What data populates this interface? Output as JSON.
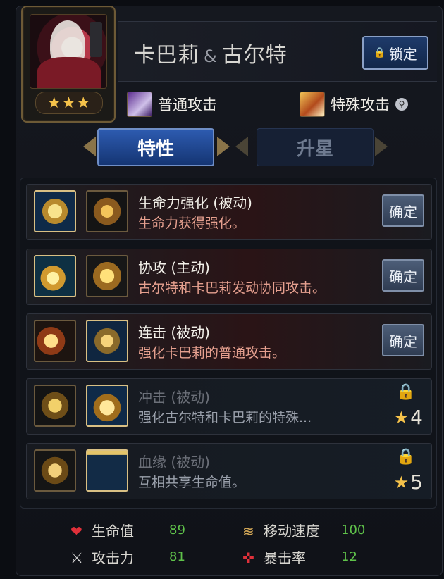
{
  "character": {
    "name_left": "卡巴莉",
    "name_amp": "&",
    "name_right": "古尔特",
    "stars": "★★★",
    "lock_label": "锁定"
  },
  "attacks": {
    "normal_label": "普通攻击",
    "special_label": "特殊攻击"
  },
  "tabs": [
    {
      "label": "特性",
      "active": true
    },
    {
      "label": "升星",
      "active": false
    }
  ],
  "traits": [
    {
      "title": "生命力强化 (被动)",
      "desc": "生命力获得强化。",
      "action": "确定",
      "locked": false
    },
    {
      "title": "协攻 (主动)",
      "desc": "古尔特和卡巴莉发动协同攻击。",
      "action": "确定",
      "locked": false
    },
    {
      "title": "连击 (被动)",
      "desc": "强化卡巴莉的普通攻击。",
      "action": "确定",
      "locked": false
    },
    {
      "title": "冲击 (被动)",
      "desc": "强化古尔特和卡巴莉的特殊...",
      "required_stars": "4",
      "locked": true
    },
    {
      "title": "血缘 (被动)",
      "desc": "互相共享生命值。",
      "required_stars": "5",
      "locked": true
    }
  ],
  "stats": {
    "hp_label": "生命值",
    "hp_value": "89",
    "atk_label": "攻击力",
    "atk_value": "81",
    "speed_label": "移动速度",
    "speed_value": "100",
    "crit_label": "暴击率",
    "crit_value": "12"
  },
  "colors": {
    "accent_blue": "#2d5bb0",
    "gold": "#f5c24a",
    "stat_value_green": "#5fc24a",
    "desc_red": "#e6a08f"
  }
}
